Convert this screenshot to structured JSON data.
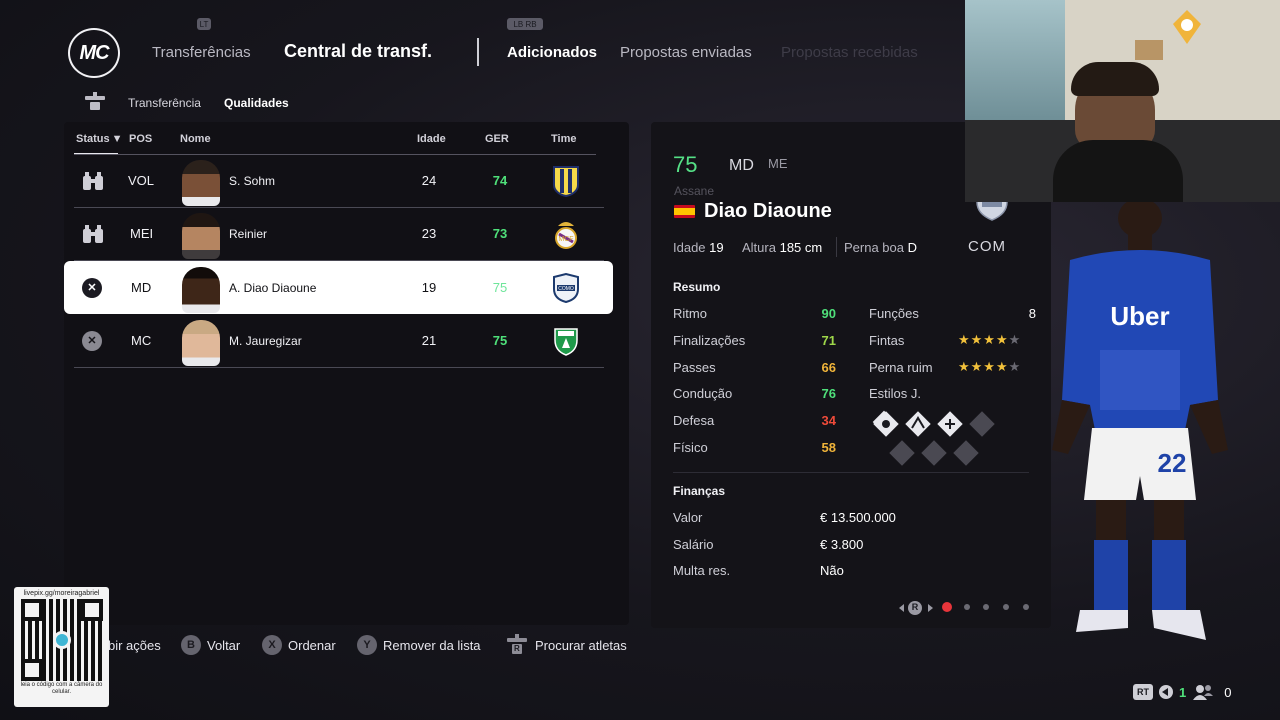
{
  "nav": {
    "logo_text": "MC",
    "transfers": "Transferências",
    "central": "Central de transf.",
    "added": "Adicionados",
    "sent_offers": "Propostas enviadas",
    "received_offers": "Propostas recebidas",
    "hint_left": "LT",
    "hint_right": "LB RB"
  },
  "subnav": {
    "transfer": "Transferência",
    "qualities": "Qualidades"
  },
  "table": {
    "headers": {
      "status": "Status",
      "sort_glyph": "▼",
      "pos": "POS",
      "name": "Nome",
      "age": "Idade",
      "ovr": "GER",
      "team": "Time"
    },
    "rows": [
      {
        "status": "scout",
        "pos": "VOL",
        "name": "S. Sohm",
        "age": "24",
        "ovr": "74",
        "team": "Parma"
      },
      {
        "status": "scout",
        "pos": "MEI",
        "name": "Reinier",
        "age": "23",
        "ovr": "73",
        "team": "Real Madrid"
      },
      {
        "status": "x",
        "pos": "MD",
        "name": "A. Diao Diaoune",
        "age": "19",
        "ovr": "75",
        "team": "Como"
      },
      {
        "status": "x",
        "pos": "MC",
        "name": "M. Jauregizar",
        "age": "21",
        "ovr": "75",
        "team": "Saint-Étienne"
      }
    ]
  },
  "player": {
    "ovr": "75",
    "pos": "MD",
    "pos_alt": "ME",
    "nickname": "Assane",
    "name": "Diao Diaoune",
    "age_label": "Idade",
    "age": "19",
    "height_label": "Altura",
    "height": "185 cm",
    "foot_label": "Perna boa",
    "foot": "D",
    "club_abbr": "COM",
    "summary_title": "Resumo",
    "stats": [
      {
        "label": "Ritmo",
        "value": "90",
        "color": "#4fe07a"
      },
      {
        "label": "Finalizações",
        "value": "71",
        "color": "#9fd84a"
      },
      {
        "label": "Passes",
        "value": "66",
        "color": "#f0b43a"
      },
      {
        "label": "Condução",
        "value": "76",
        "color": "#4fe07a"
      },
      {
        "label": "Defesa",
        "value": "34",
        "color": "#ef4b3a"
      },
      {
        "label": "Físico",
        "value": "58",
        "color": "#f0b43a"
      }
    ],
    "roles_label": "Funções",
    "roles_value": "8",
    "skill_moves_label": "Fintas",
    "skill_moves_stars": 4,
    "weak_foot_label": "Perna ruim",
    "weak_foot_stars": 4,
    "playstyles_label": "Estilos J.",
    "finance_title": "Finanças",
    "value_label": "Valor",
    "value": "€ 13.500.000",
    "wage_label": "Salário",
    "wage": "€ 3.800",
    "clause_label": "Multa res.",
    "clause": "Não",
    "pager_label": "R",
    "pager_pages": 5,
    "pager_active": 1
  },
  "hints": {
    "actions": "bir ações",
    "back_btn": "B",
    "back": "Voltar",
    "sort_btn": "X",
    "sort": "Ordenar",
    "remove_btn": "Y",
    "remove": "Remover da lista",
    "search_btn": "R",
    "search": "Procurar atletas"
  },
  "qr": {
    "top": "livepix.gg/moreiragabriel",
    "bottom": "leia o código com a câmera do celular."
  },
  "hud": {
    "rt": "RT",
    "count_a": "1",
    "count_b": "0"
  },
  "kit": {
    "sponsor": "Uber",
    "number": "22"
  },
  "colors": {
    "accent_green": "#4fe07a",
    "selected_row": "#ffffff",
    "star": "#f2c13b",
    "pager_active": "#e8353b"
  }
}
